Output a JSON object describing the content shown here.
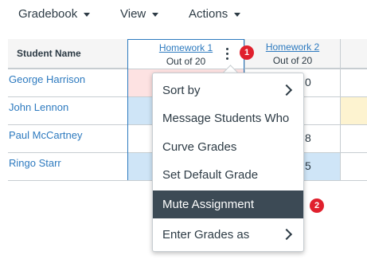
{
  "topmenu": {
    "gradebook": "Gradebook",
    "view": "View",
    "actions": "Actions"
  },
  "gradebook": {
    "student_name_header": "Student Name",
    "assignments": [
      {
        "title": "Homework 1",
        "subtitle": "Out of 20"
      },
      {
        "title": "Homework 2",
        "subtitle": "Out of 20"
      }
    ],
    "students": [
      "George Harrison",
      "John Lennon",
      "Paul McCartney",
      "Ringo Starr"
    ],
    "partial_scores": [
      "0",
      "",
      "8",
      "5"
    ]
  },
  "menu": {
    "items": [
      {
        "label": "Sort by"
      },
      {
        "label": "Message Students Who"
      },
      {
        "label": "Curve Grades"
      },
      {
        "label": "Set Default Grade"
      },
      {
        "label": "Mute Assignment"
      },
      {
        "label": "Enter Grades as"
      }
    ]
  },
  "badges": [
    "1",
    "2"
  ],
  "colors": {
    "link": "#2d7abf",
    "badge": "#e0202d",
    "menu_active_bg": "#3c4a55",
    "cell_pink": "#fde2e2",
    "cell_blue": "#cfe5f7",
    "cell_yellow": "#fdf3d0"
  }
}
